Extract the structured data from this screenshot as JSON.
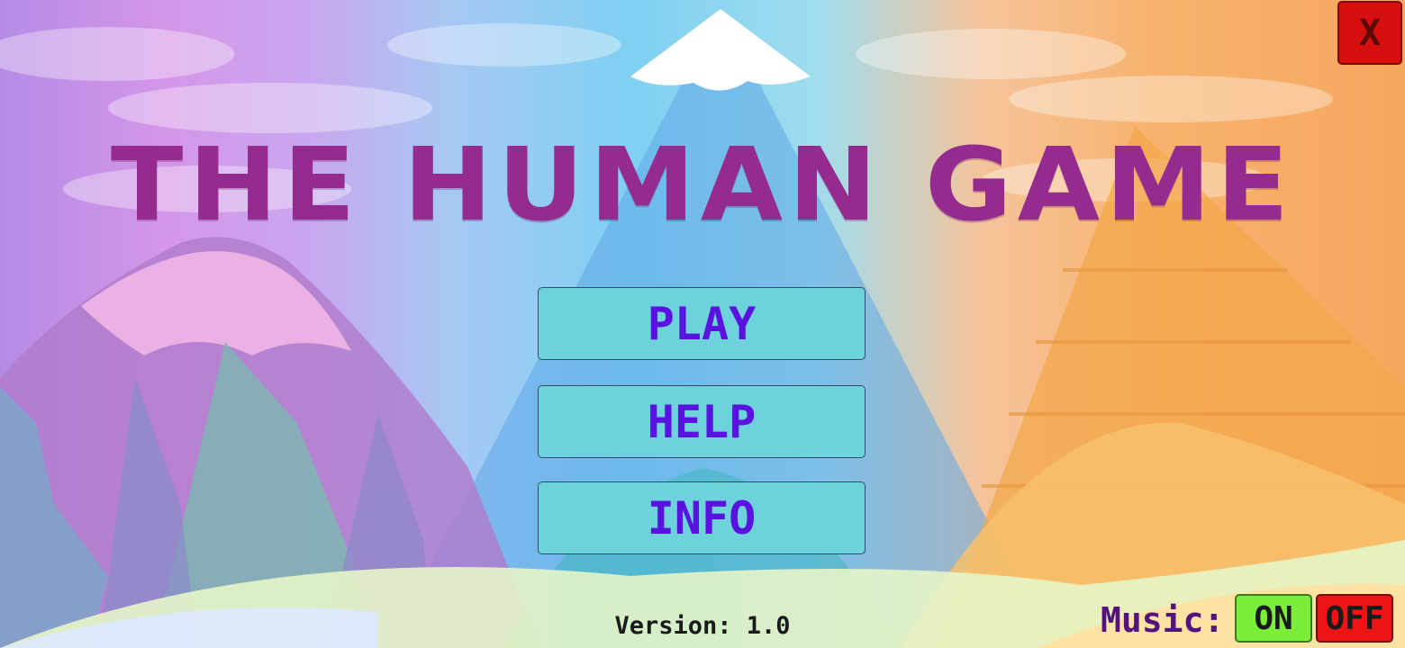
{
  "game": {
    "title": "THE HUMAN GAME",
    "version": "Version: 1.0"
  },
  "menu": {
    "play_label": "PLAY",
    "help_label": "HELP",
    "info_label": "INFO"
  },
  "window": {
    "close_label": "X"
  },
  "music": {
    "label": "Music:",
    "on_label": "ON",
    "off_label": "OFF"
  },
  "colors": {
    "title": "#952b8f",
    "button_bg": "#6ed2dd",
    "button_text": "#5a12e0",
    "close_bg": "#d80f0f",
    "music_on_bg": "#7cee3a",
    "music_off_bg": "#ec1414",
    "music_label": "#55127a"
  }
}
